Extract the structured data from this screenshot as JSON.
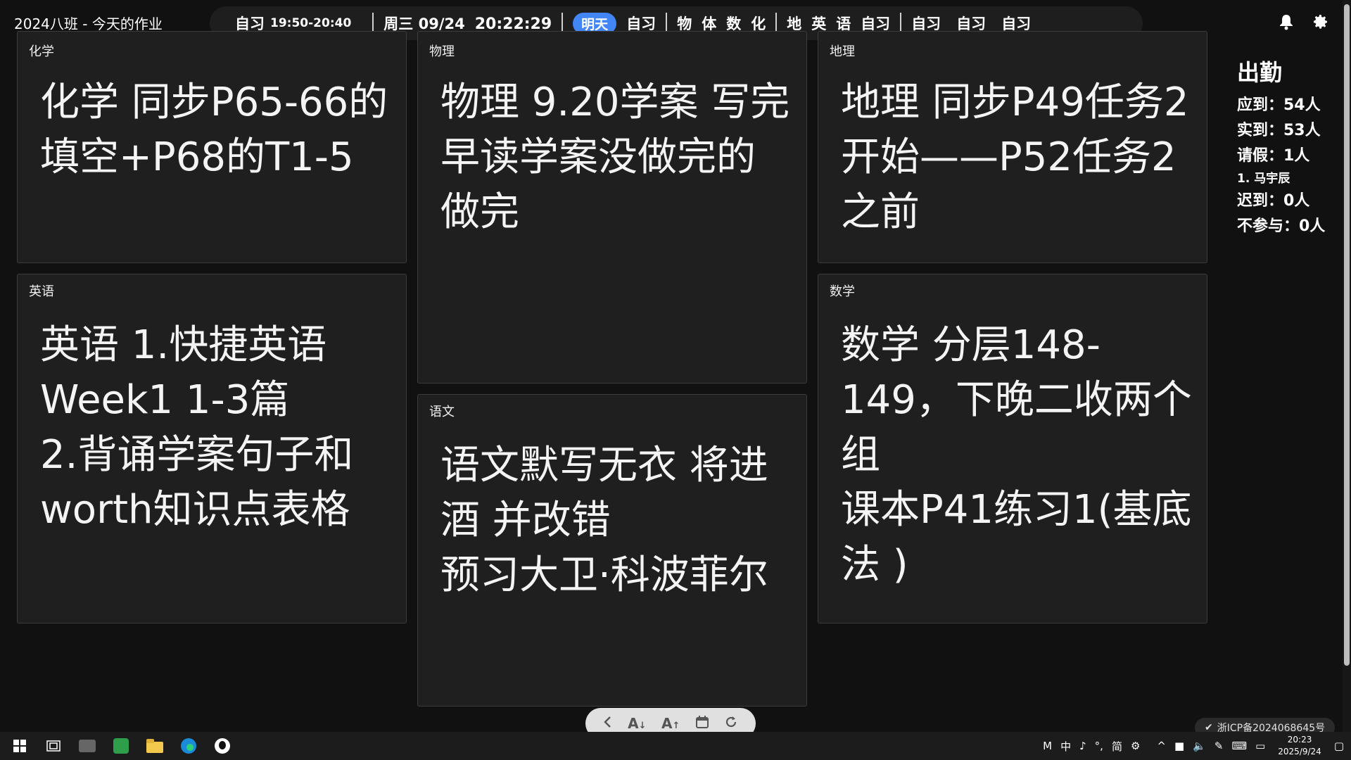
{
  "app": {
    "title": "2024八班 - 今天的作业"
  },
  "topbar": {
    "current_period": {
      "label": "自习",
      "range": "19:50-20:40",
      "progress": 0.64
    },
    "date": "周三 09/24",
    "time": "20:22:29",
    "tomorrow_label": "明天",
    "group1": [
      "自习"
    ],
    "group2": [
      "物",
      "体",
      "数",
      "化"
    ],
    "group3": [
      "地",
      "英",
      "语",
      "自习"
    ],
    "group4": [
      "自习",
      "自习",
      "自习"
    ]
  },
  "cards": {
    "chemistry": {
      "label": "化学",
      "lines": [
        "化学 同步P65-66的填空+P68的T1-5"
      ]
    },
    "physics": {
      "label": "物理",
      "lines": [
        "物理 9.20学案 写完早读学案没做完的做完"
      ]
    },
    "geography": {
      "label": "地理",
      "lines": [
        "地理 同步P49任务2开始——P52任务2之前"
      ]
    },
    "english": {
      "label": "英语",
      "lines": [
        "英语 1.快捷英语Week1 1-3篇",
        "2.背诵学案句子和worth知识点表格"
      ]
    },
    "chinese": {
      "label": "语文",
      "lines": [
        "语文默写无衣 将进酒 并改错",
        "预习大卫·科波菲尔"
      ]
    },
    "math": {
      "label": "数学",
      "lines": [
        "数学 分层148-149，下晚二收两个组",
        "课本P41练习1(基底法 )"
      ]
    }
  },
  "attendance": {
    "title": "出勤",
    "expected": "应到：54人",
    "actual": "实到：53人",
    "leave": "请假：1人",
    "leave_names": [
      "1. 马宇辰"
    ],
    "late": "迟到：0人",
    "absent": "不参与：0人"
  },
  "icp": "浙ICP备2024068645号",
  "taskbar": {
    "ime": [
      "M",
      "中",
      "♪",
      "°,",
      "简",
      "⚙"
    ],
    "time": "20:23",
    "date": "2025/9/24"
  },
  "colors": {
    "accent": "#4285f4",
    "progress": "#5a8fe0",
    "card_bg": "#1f1f1f",
    "page_bg": "#111111"
  }
}
